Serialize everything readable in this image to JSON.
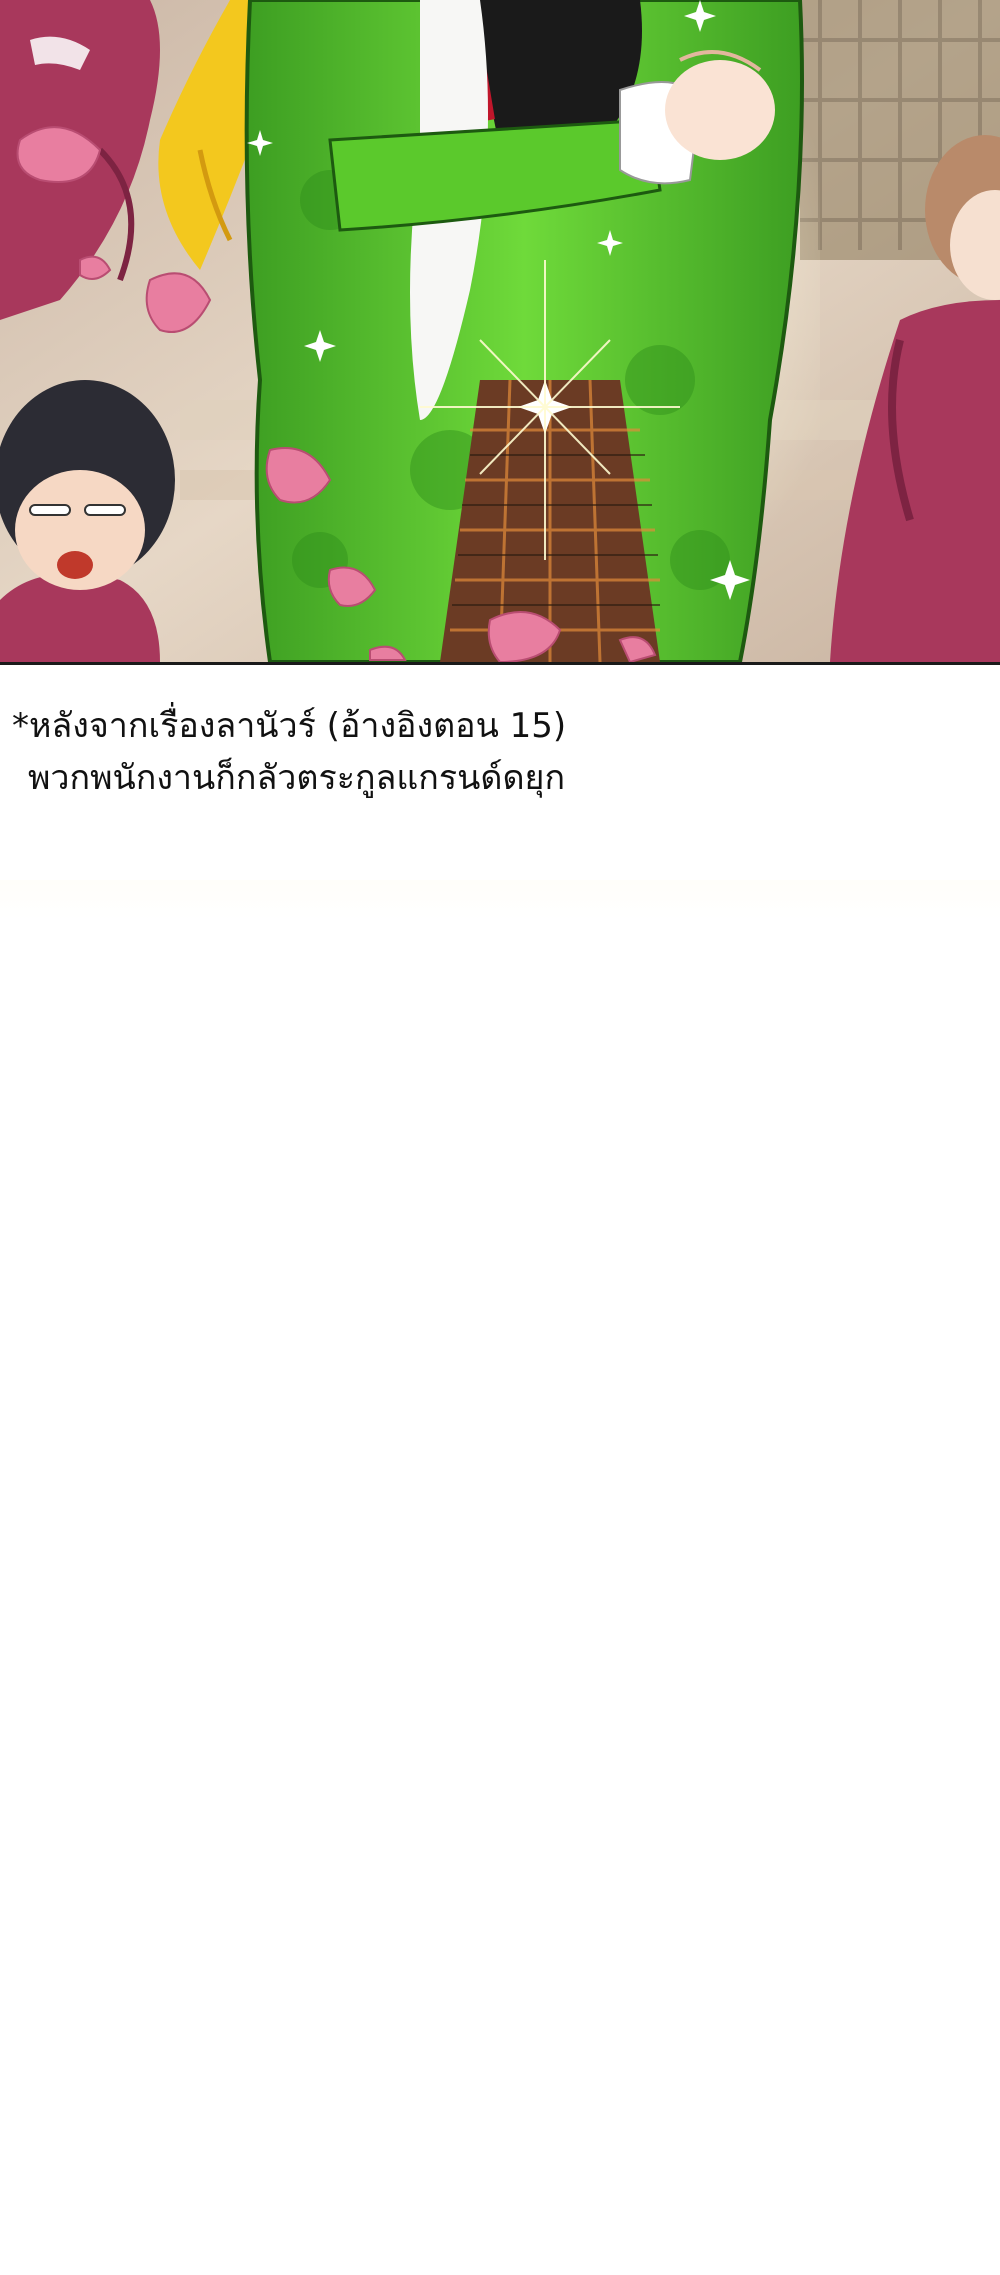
{
  "panel": {
    "illustration": "manga-panel",
    "palette": {
      "jacket": "#5fcf2f",
      "jacket_dark": "#2f8f1a",
      "uniform": "#a8385c",
      "background": "#d9c8b8",
      "petal": "#e87ea0",
      "hair_blonde": "#f3c81e",
      "skirt": "#6b3b24"
    }
  },
  "caption": {
    "line1": "*หลังจากเรื่องลานัวร์ (อ้างอิงตอน 15)",
    "line2": "พวกพนักงานก็กลัวตระกูลแกรนด์ดยุก"
  }
}
